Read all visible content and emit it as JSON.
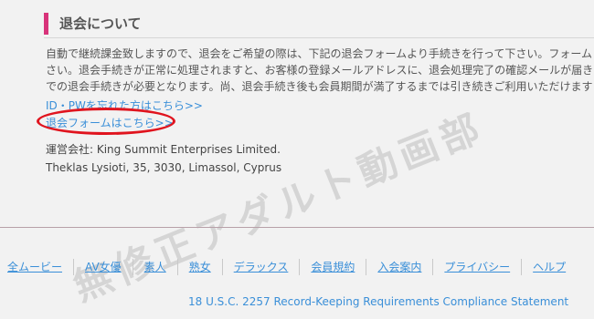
{
  "section": {
    "title": "退会について"
  },
  "body": {
    "lines": [
      "自動で継続課金致しますので、退会をご希望の際は、下記の退会フォームより手続きを行って下さい。フォーム",
      "さい。退会手続きが正常に処理されますと、お客様の登録メールアドレスに、退会処理完了の確認メールが届き",
      "での退会手続きが必要となります。尚、退会手続き後も会員期間が満了するまでは引き続きご利用いただけます"
    ],
    "pw_link": "ID・PWを忘れた方はこちら>>",
    "cancel_link": "退会フォームはこちら>>"
  },
  "company": {
    "line1": "運営会社: King Summit Enterprises Limited.",
    "line2": "Theklas Lysioti, 35, 3030, Limassol, Cyprus"
  },
  "watermark": "無修正アダルト動画部",
  "footer": {
    "nav": [
      "全ムービー",
      "AV女優",
      "素人",
      "熟女",
      "デラックス",
      "会員規約",
      "入会案内",
      "プライバシー",
      "ヘルプ"
    ],
    "compliance": "18 U.S.C. 2257 Record-Keeping Requirements Compliance Statement"
  },
  "colors": {
    "accent": "#d8337a",
    "link": "#3a8fd8",
    "highlight": "#e0141e"
  }
}
